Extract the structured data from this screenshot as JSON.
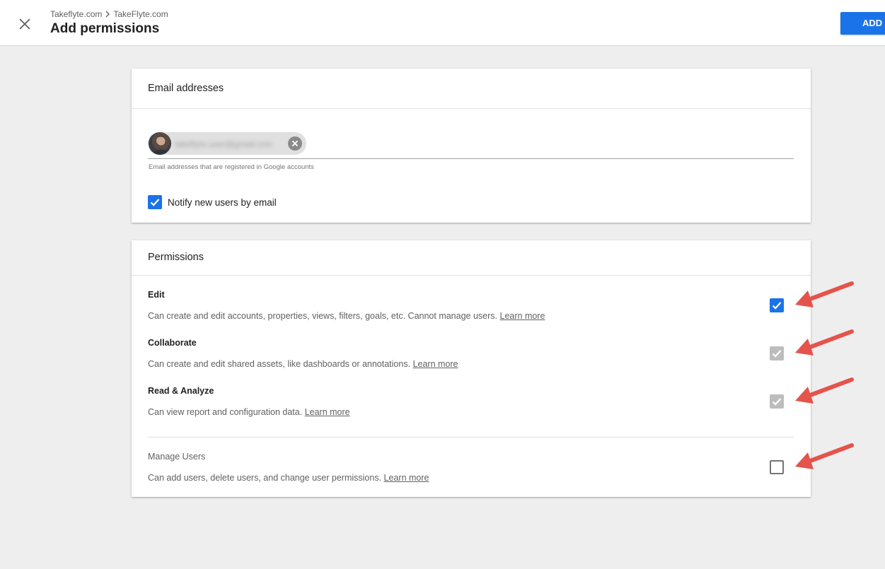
{
  "header": {
    "breadcrumb": [
      "Takeflyte.com",
      "TakeFlyte.com"
    ],
    "title": "Add permissions",
    "add_button": "ADD",
    "close_icon": "close-icon"
  },
  "email_section": {
    "title": "Email addresses",
    "chip_email": "takeflyte.user@gmail.com",
    "hint": "Email addresses that are registered in Google accounts",
    "notify_label": "Notify new users by email",
    "notify_checked": true
  },
  "permissions_section": {
    "title": "Permissions",
    "items": [
      {
        "title": "Edit",
        "desc": "Can create and edit accounts, properties, views, filters, goals, etc. Cannot manage users.",
        "link": "Learn more",
        "state": "checked"
      },
      {
        "title": "Collaborate",
        "desc": "Can create and edit shared assets, like dashboards or annotations.",
        "link": "Learn more",
        "state": "checked-disabled"
      },
      {
        "title": "Read & Analyze",
        "desc": "Can view report and configuration data.",
        "link": "Learn more",
        "state": "checked-disabled"
      },
      {
        "title": "Manage Users",
        "desc": "Can add users, delete users, and change user permissions.",
        "link": "Learn more",
        "state": "unchecked"
      }
    ]
  },
  "colors": {
    "accent": "#1a73e8",
    "annotation_arrow": "#e5534b",
    "disabled_check": "#bdbdbd"
  }
}
